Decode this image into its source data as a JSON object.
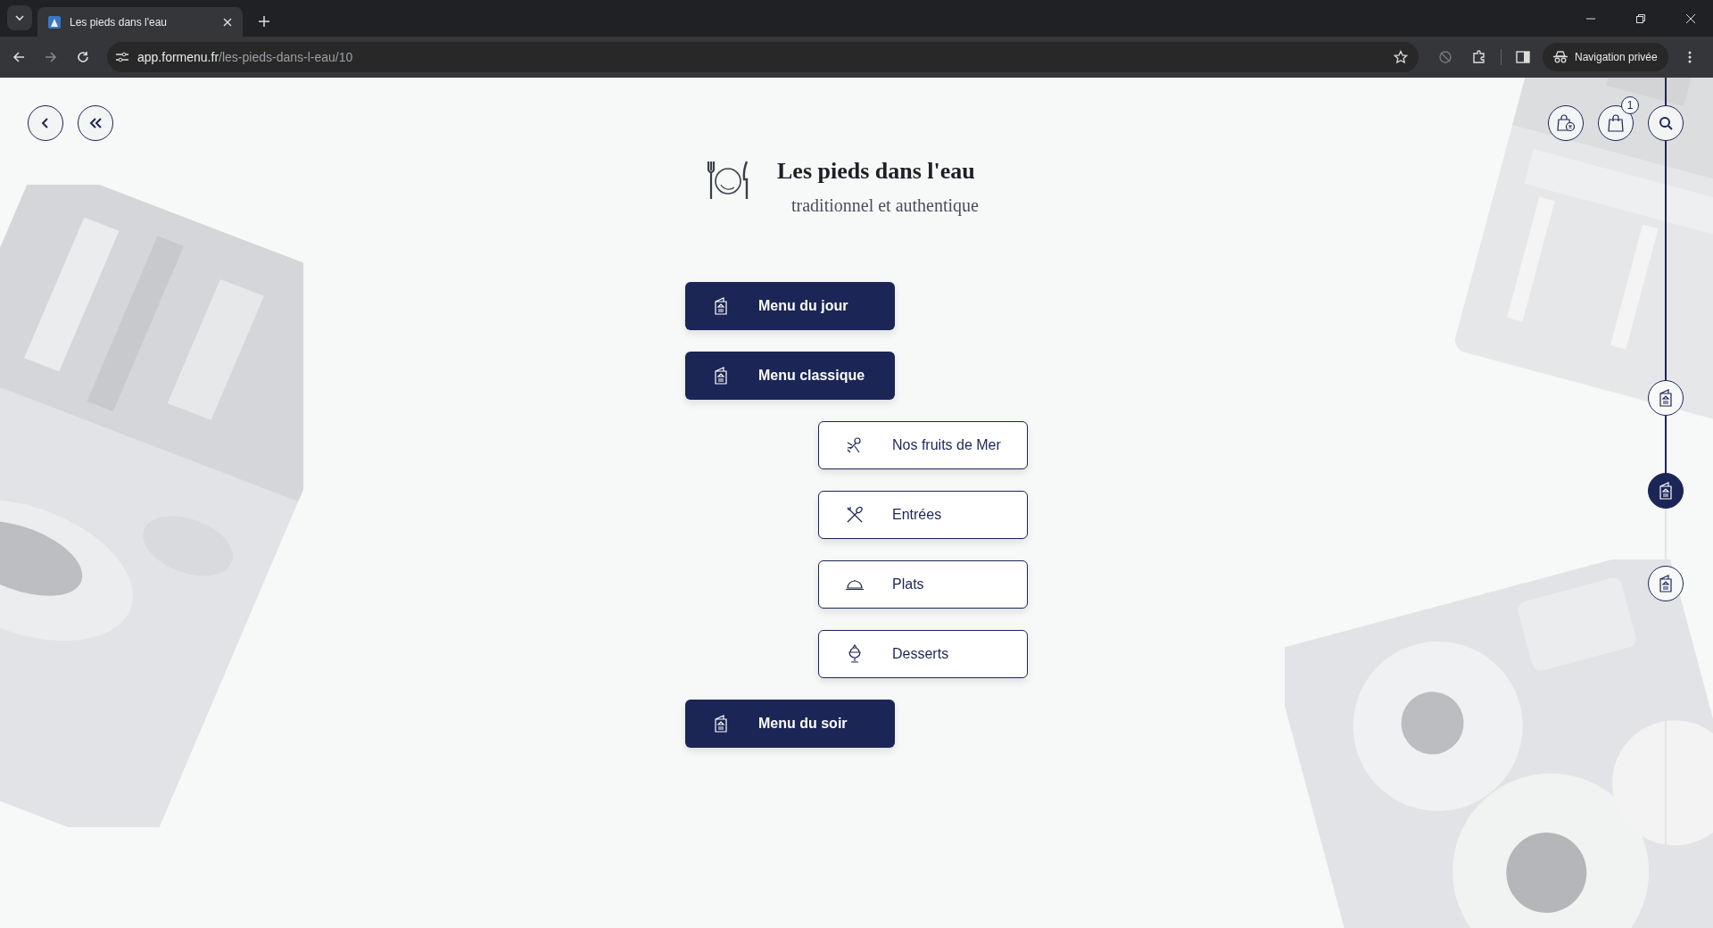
{
  "browser": {
    "tab_title": "Les pieds dans l'eau",
    "url_host": "app.formenu.fr",
    "url_path": "/les-pieds-dans-l-eau/10",
    "profile_label": "Navigation privée"
  },
  "restaurant": {
    "name": "Les pieds dans l'eau",
    "tagline": "traditionnel et authentique"
  },
  "cart": {
    "count": "1"
  },
  "menus": [
    {
      "kind": "menu",
      "label": "Menu du jour"
    },
    {
      "kind": "menu",
      "label": "Menu classique"
    },
    {
      "kind": "seafood",
      "label": "Nos fruits de Mer"
    },
    {
      "kind": "starter",
      "label": "Entrées"
    },
    {
      "kind": "main",
      "label": "Plats"
    },
    {
      "kind": "dessert",
      "label": "Desserts"
    },
    {
      "kind": "menu",
      "label": "Menu du soir"
    }
  ],
  "timeline": [
    {
      "selected": false
    },
    {
      "selected": true
    },
    {
      "selected": false
    }
  ]
}
